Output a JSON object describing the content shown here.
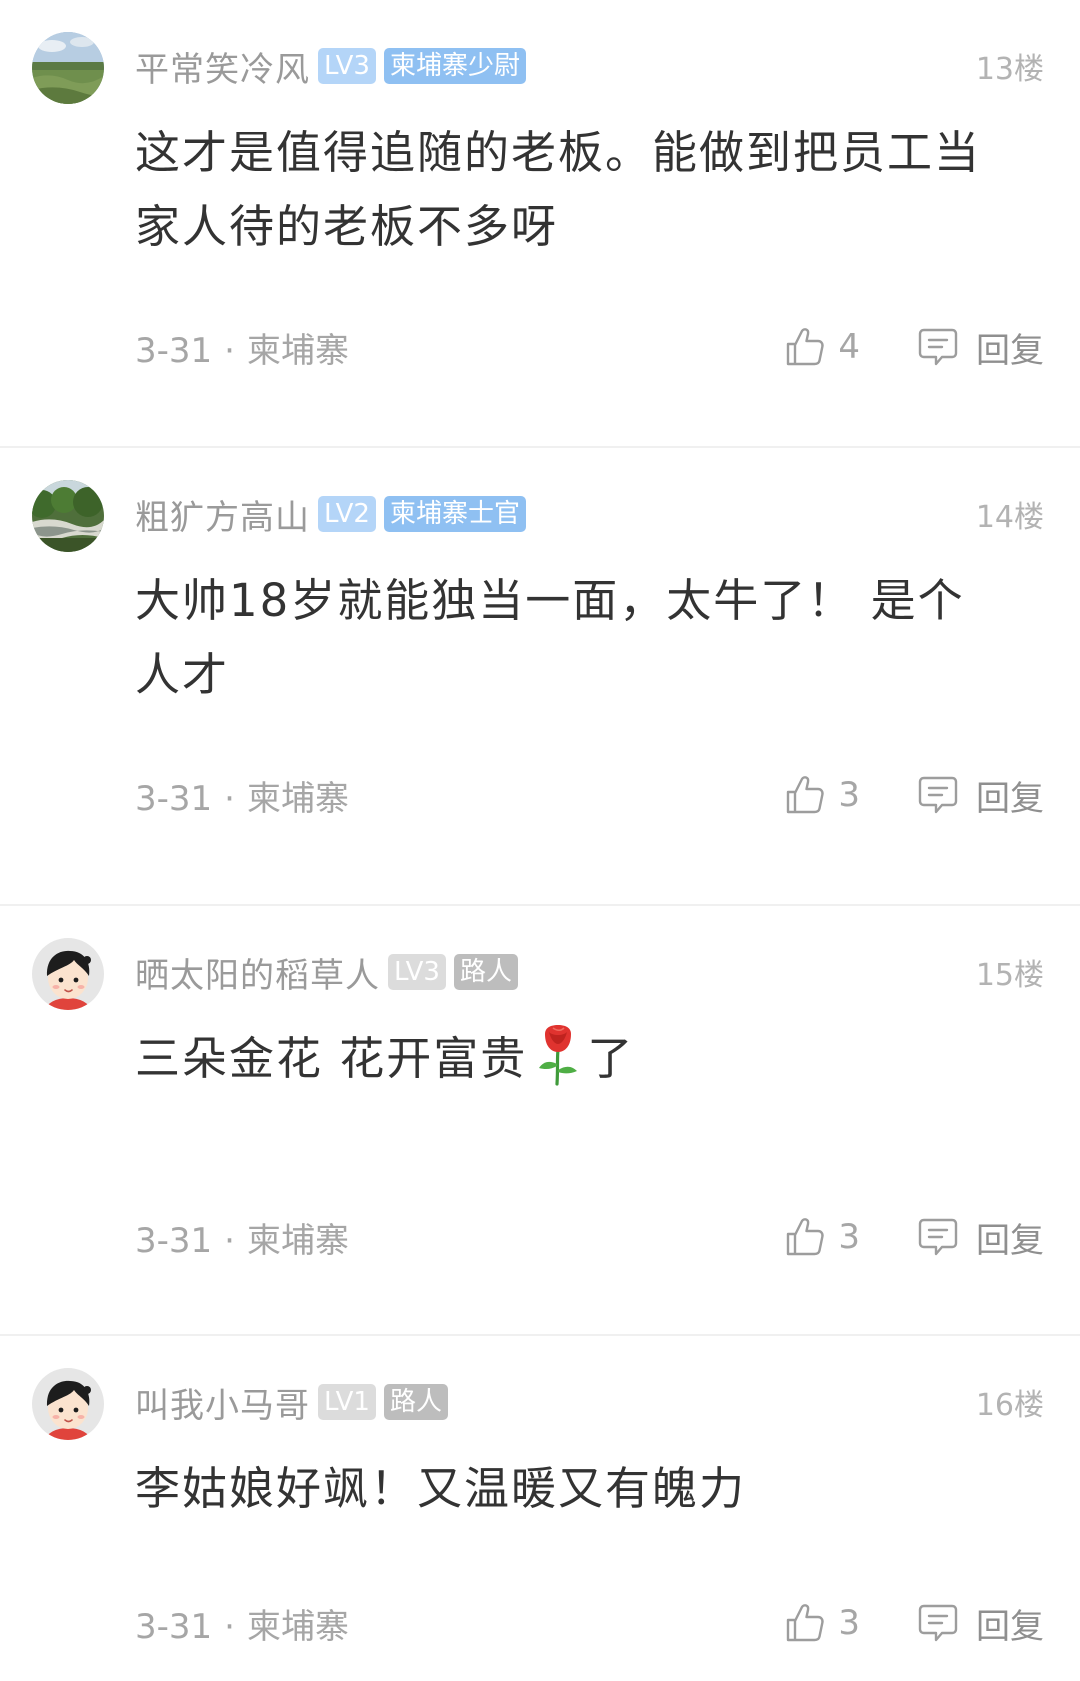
{
  "comments": [
    {
      "avatar_icon": "landscape-field-avatar",
      "username": "平常笑冷风",
      "level": "LV3",
      "title": "柬埔寨少尉",
      "floor": "13楼",
      "content_lines": [
        "这才是值得追随的老板。能做到把员工当",
        "家人待的老板不多呀"
      ],
      "date": "3-31",
      "location": "柬埔寨",
      "likes": "4",
      "reply_label": "回复"
    },
    {
      "avatar_icon": "river-forest-avatar",
      "username": "粗犷方高山",
      "level": "LV2",
      "title": "柬埔寨士官",
      "floor": "14楼",
      "content_lines": [
        "大帅18岁就能独当一面，太牛了！ 是个",
        "人才"
      ],
      "date": "3-31",
      "location": "柬埔寨",
      "likes": "3",
      "reply_label": "回复"
    },
    {
      "avatar_icon": "cartoon-boy-avatar",
      "username": "晒太阳的稻草人",
      "level": "LV3",
      "title": "路人",
      "floor": "15楼",
      "content_before": "三朵金花 花开富贵",
      "content_emoji": "rose-emoji",
      "content_after": "了",
      "date": "3-31",
      "location": "柬埔寨",
      "likes": "3",
      "reply_label": "回复"
    },
    {
      "avatar_icon": "cartoon-boy-avatar",
      "username": "叫我小马哥",
      "level": "LV1",
      "title": "路人",
      "floor": "16楼",
      "content_lines": [
        "李姑娘好飒！又温暖又有魄力"
      ],
      "date": "3-31",
      "location": "柬埔寨",
      "likes": "3",
      "reply_label": "回复"
    }
  ],
  "meta_separator": "·",
  "colors": {
    "username": "#9a9a9a",
    "content": "#333333",
    "meta": "#a6a6a6",
    "badge_blue": "#8fc0f2",
    "badge_gray": "#bdbdbd",
    "divider": "#f0f0f0"
  }
}
